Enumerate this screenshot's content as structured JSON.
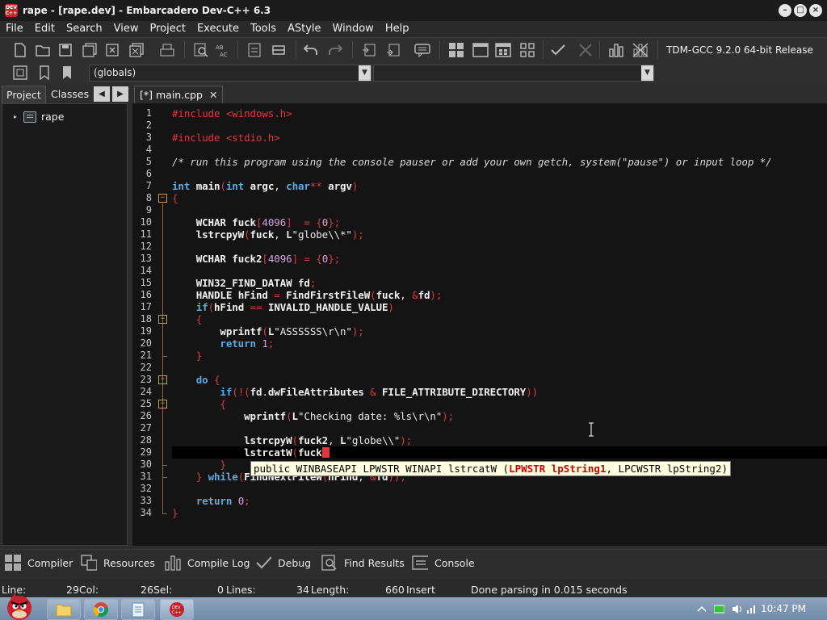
{
  "window": {
    "title": "rape - [rape.dev] - Embarcadero Dev-C++ 6.3",
    "app_icon_text": "DEV C++"
  },
  "menu": [
    "File",
    "Edit",
    "Search",
    "View",
    "Project",
    "Execute",
    "Tools",
    "AStyle",
    "Window",
    "Help"
  ],
  "toolbar": {
    "compiler": "TDM-GCC 9.2.0 64-bit Release"
  },
  "scope_combo": {
    "value": "(globals)"
  },
  "left_panel": {
    "tabs": [
      "Project",
      "Classes"
    ],
    "project_node": "rape"
  },
  "editor": {
    "tab_label": "[*] main.cpp",
    "line_numbers": [
      "1",
      "2",
      "3",
      "4",
      "5",
      "6",
      "7",
      "8",
      "9",
      "10",
      "11",
      "12",
      "13",
      "14",
      "15",
      "16",
      "17",
      "18",
      "19",
      "20",
      "21",
      "22",
      "23",
      "24",
      "25",
      "26",
      "27",
      "28",
      "29",
      "30",
      "31",
      "32",
      "33",
      "34"
    ],
    "lines": [
      "#include <windows.h>",
      "",
      "#include <stdio.h>",
      "",
      "/* run this program using the console pauser or add your own getch, system(\"pause\") or input loop */",
      "",
      "int main(int argc, char** argv)",
      "{",
      "",
      "    WCHAR fuck[4096]  = {0};",
      "    lstrcpyW(fuck, L\"globe\\\\*\");",
      "",
      "    WCHAR fuck2[4096] = {0};",
      "",
      "    WIN32_FIND_DATAW fd;",
      "    HANDLE hFind = FindFirstFileW(fuck, &fd);",
      "    if(hFind == INVALID_HANDLE_VALUE)",
      "    {",
      "        wprintf(L\"ASSSSSS\\r\\n\");",
      "        return 1;",
      "    }",
      "",
      "    do {",
      "        if(!(fd.dwFileAttributes & FILE_ATTRIBUTE_DIRECTORY))",
      "        {",
      "            wprintf(L\"Checking date: %ls\\r\\n\");",
      "",
      "            lstrcpyW(fuck2, L\"globe\\\\\");",
      "            lstrcatW(fuck",
      "        }",
      "    } while(FindNextFileW(hFind, &fd));",
      "",
      "    return 0;",
      "}"
    ],
    "tooltip": {
      "prefix": "public WINBASEAPI LPWSTR WINAPI lstrcatW (",
      "highlight": "LPWSTR lpString1",
      "suffix": ", LPCWSTR lpString2)"
    }
  },
  "bottom_tabs": [
    "Compiler",
    "Resources",
    "Compile Log",
    "Debug",
    "Find Results",
    "Console"
  ],
  "status": {
    "line_label": "Line:",
    "line": "29",
    "col_label": "Col:",
    "col": "26",
    "sel_label": "Sel:",
    "sel": "0",
    "lines_label": "Lines:",
    "lines": "34",
    "length_label": "Length:",
    "length": "660",
    "mode": "Insert",
    "message": "Done parsing in 0.015 seconds"
  },
  "taskbar": {
    "clock": "10:47 PM"
  }
}
